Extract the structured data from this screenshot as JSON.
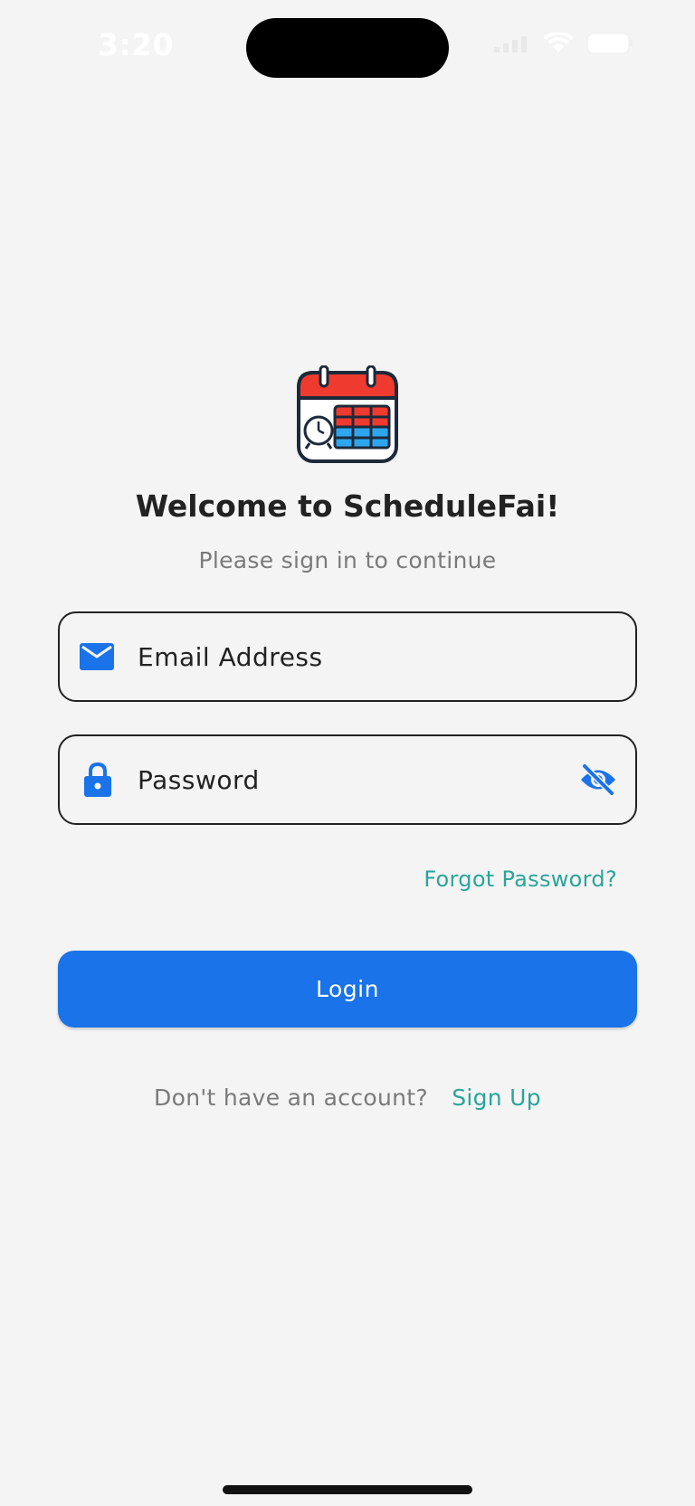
{
  "status_bar": {
    "time": "3:20"
  },
  "header": {
    "title": "Welcome to ScheduleFai!",
    "subtitle": "Please sign in to continue"
  },
  "form": {
    "email_placeholder": "Email Address",
    "password_placeholder": "Password",
    "forgot_password_label": "Forgot Password?",
    "login_label": "Login"
  },
  "footer": {
    "question": "Don't have an account?",
    "signup_label": "Sign Up"
  },
  "icons": {
    "logo": "calendar-clock-icon",
    "email": "envelope-icon",
    "password": "lock-icon",
    "toggle_visibility": "eye-off-icon"
  },
  "colors": {
    "background": "#f4f4f4",
    "accent": "#1a73e8",
    "link": "#2aa59a",
    "text": "#222222",
    "muted": "#7a7a7a"
  }
}
